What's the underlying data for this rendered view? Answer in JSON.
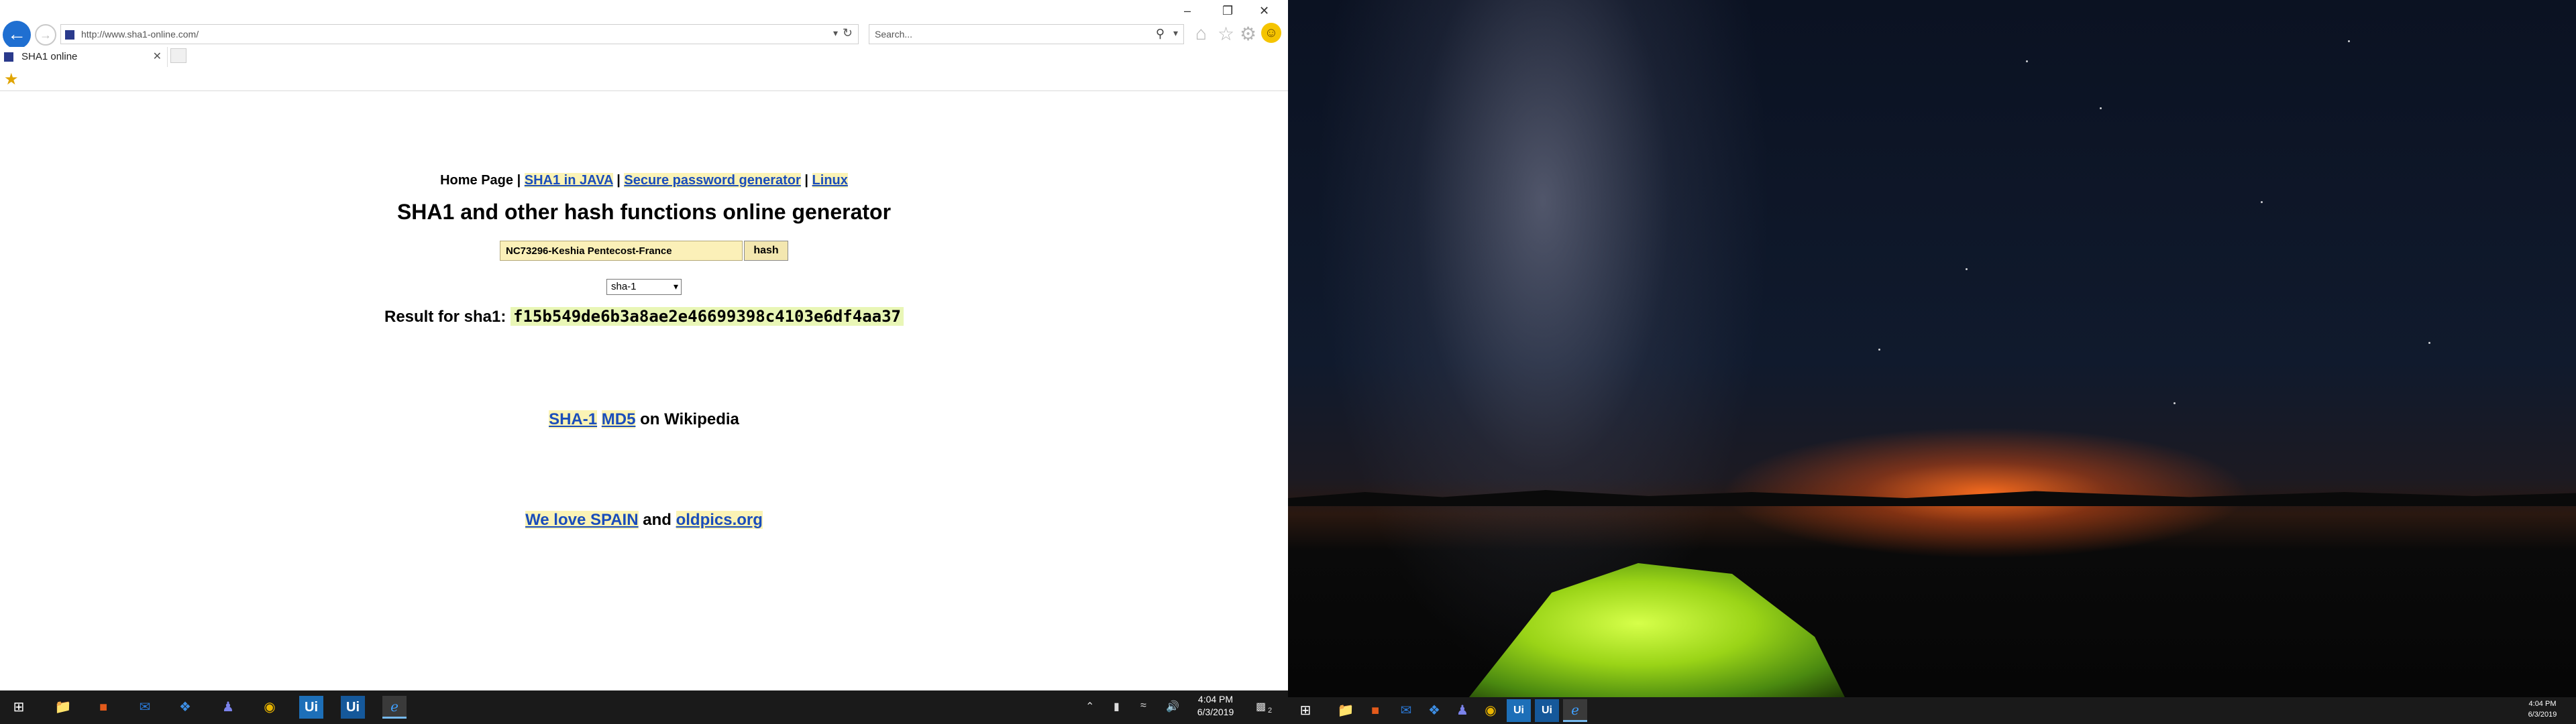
{
  "browser": {
    "url": "http://www.sha1-online.com/",
    "search_placeholder": "Search...",
    "tab_title": "SHA1 online"
  },
  "page": {
    "nav": {
      "home": "Home Page",
      "sha1_java": "SHA1 in JAVA",
      "password_gen": "Secure password generator",
      "linux": "Linux",
      "separator": "|"
    },
    "title": "SHA1 and other hash functions online generator",
    "input_value": "NC73296-Keshia Pentecost-France",
    "hash_button": "hash",
    "algorithm": "sha-1",
    "result_label": "Result for sha1:",
    "result_value": "f15b549de6b3a8ae2e46699398c4103e6df4aa37",
    "wiki_sha1": "SHA-1",
    "wiki_md5": "MD5",
    "wiki_suffix": "on Wikipedia",
    "spain_link": "We love SPAIN",
    "and_text": "and",
    "oldpics_link": "oldpics.org"
  },
  "taskbar_left": {
    "time": "4:04 PM",
    "date": "6/3/2019",
    "notifications": "2"
  },
  "taskbar_right": {
    "time": "4:04 PM",
    "date": "6/3/2019"
  },
  "colors": {
    "link": "#1a4dbb",
    "link_highlight": "#fbf3b5",
    "input_bg": "#fbf0b8",
    "result_bg": "#e9f6b6",
    "ie_blue": "#1f6fd1"
  }
}
